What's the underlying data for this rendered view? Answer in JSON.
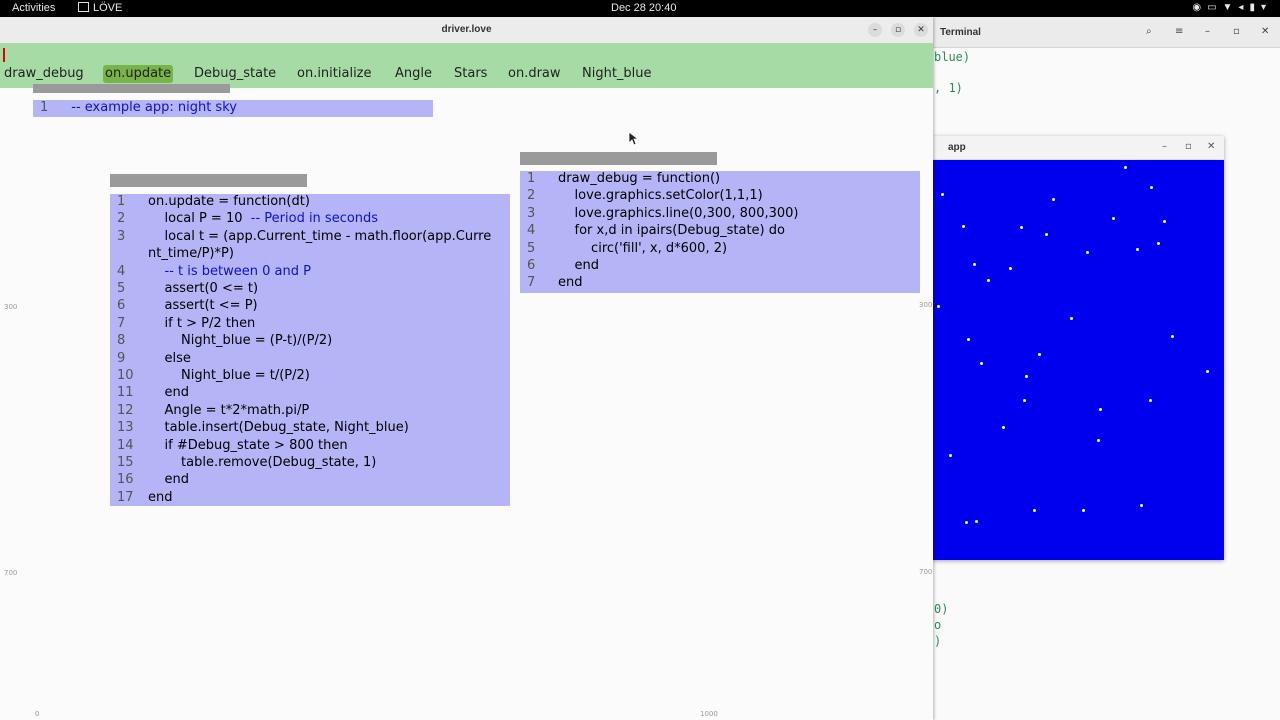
{
  "topbar": {
    "activities": "Activities",
    "app_name": "LÖVE",
    "clock": "Dec 28  20:40"
  },
  "terminal": {
    "title": "Terminal",
    "lines": [
      "blue)",
      ", 1)",
      "0)",
      "o",
      ")"
    ]
  },
  "app_window": {
    "title": "app",
    "sky_color": "#0000ee"
  },
  "driver": {
    "title": "driver.love",
    "tabs": [
      "draw_debug",
      "on.update",
      "Debug_state",
      "on.initialize",
      "Angle",
      "Stars",
      "on.draw",
      "Night_blue"
    ],
    "selected_tab": "on.update",
    "ruler": {
      "y300": "300",
      "y700": "700",
      "x0": "0",
      "x1000": "1000",
      "r300": "300",
      "r700": "700"
    },
    "panes": {
      "example": {
        "lines": [
          {
            "n": "1",
            "code": "  -- example app: night sky",
            "comment": true
          }
        ]
      },
      "on_update": {
        "lines": [
          {
            "n": "1",
            "code": "on.update = function(dt)"
          },
          {
            "n": "2",
            "code": "    local P = 10",
            "tail": "  -- Period in seconds"
          },
          {
            "n": "3",
            "code": "    local t = (app.Current_time - math.floor(app.Curre"
          },
          {
            "n": "",
            "code": "nt_time/P)*P)"
          },
          {
            "n": "4",
            "code": "    -- t is between 0 and P",
            "comment": true
          },
          {
            "n": "5",
            "code": "    assert(0 <= t)"
          },
          {
            "n": "6",
            "code": "    assert(t <= P)"
          },
          {
            "n": "7",
            "code": "    if t > P/2 then"
          },
          {
            "n": "8",
            "code": "        Night_blue = (P-t)/(P/2)"
          },
          {
            "n": "9",
            "code": "    else"
          },
          {
            "n": "10",
            "code": "        Night_blue = t/(P/2)"
          },
          {
            "n": "11",
            "code": "    end"
          },
          {
            "n": "12",
            "code": "    Angle = t*2*math.pi/P"
          },
          {
            "n": "13",
            "code": "    table.insert(Debug_state, Night_blue)"
          },
          {
            "n": "14",
            "code": "    if #Debug_state > 800 then"
          },
          {
            "n": "15",
            "code": "        table.remove(Debug_state, 1)"
          },
          {
            "n": "16",
            "code": "    end"
          },
          {
            "n": "17",
            "code": "end"
          }
        ]
      },
      "draw_debug": {
        "lines": [
          {
            "n": "1",
            "code": "draw_debug = function()"
          },
          {
            "n": "2",
            "code": "    love.graphics.setColor(1,1,1)"
          },
          {
            "n": "3",
            "code": "    love.graphics.line(0,300, 800,300)"
          },
          {
            "n": "4",
            "code": "    for x,d in ipairs(Debug_state) do"
          },
          {
            "n": "5",
            "code": "        circ('fill', x, d*600, 2)"
          },
          {
            "n": "6",
            "code": "    end"
          },
          {
            "n": "7",
            "code": "end"
          }
        ]
      }
    }
  }
}
